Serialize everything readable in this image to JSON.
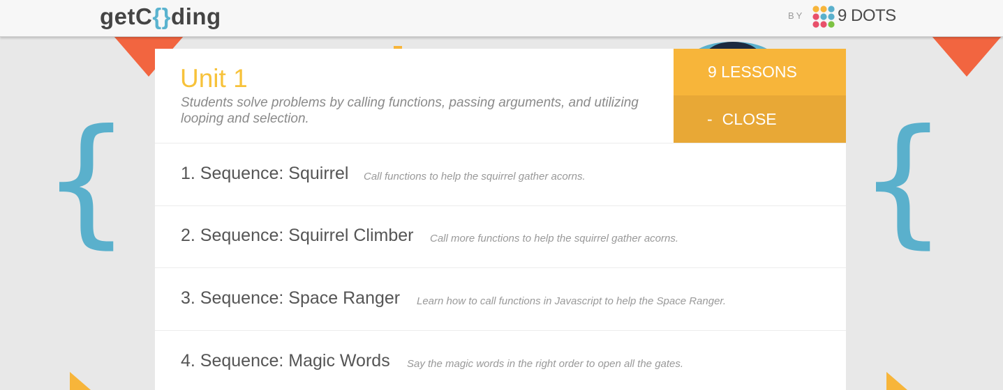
{
  "header": {
    "logo_prefix": "getC",
    "logo_brace": "{}",
    "logo_suffix": "ding",
    "by_label": "BY",
    "partner_name": "9 DOTS"
  },
  "colors": {
    "accent_yellow": "#f7c23a",
    "lessons_button": "#f7b53a",
    "close_button": "#e8a836",
    "brace_blue": "#5ab0cc",
    "arrow_orange": "#f26540"
  },
  "unit": {
    "title": "Unit 1",
    "description": "Students solve problems by calling functions, passing arguments, and utilizing looping and selection.",
    "lessons_label": "9 LESSONS",
    "close_dash": "-",
    "close_label": "CLOSE"
  },
  "lessons": [
    {
      "title": "1. Sequence: Squirrel",
      "description": "Call functions to help the squirrel gather acorns."
    },
    {
      "title": "2. Sequence: Squirrel Climber",
      "description": "Call more functions to help the squirrel gather acorns."
    },
    {
      "title": "3. Sequence: Space Ranger",
      "description": "Learn how to call functions in Javascript to help the Space Ranger."
    },
    {
      "title": "4. Sequence: Magic Words",
      "description": "Say the magic words in the right order to open all the gates."
    }
  ],
  "icons": {
    "left_brace": "{",
    "right_brace": "{"
  }
}
